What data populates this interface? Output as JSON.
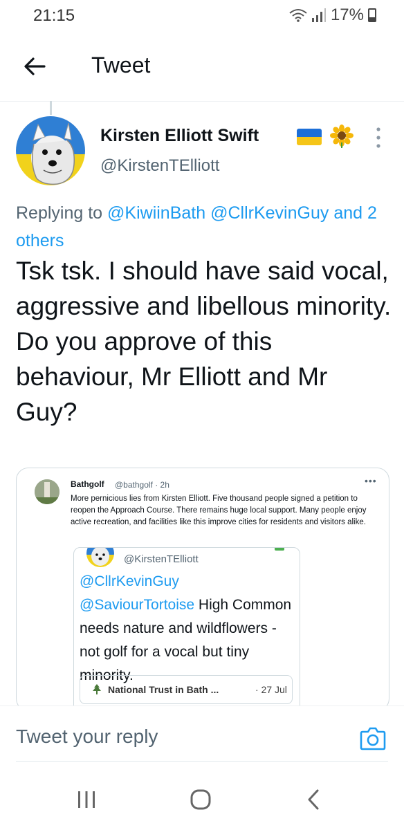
{
  "status_bar": {
    "time": "21:15",
    "battery": "17%"
  },
  "header": {
    "title": "Tweet"
  },
  "tweet": {
    "author_name": "Kirsten Elliott Swift",
    "author_handle": "@KirstenTElliott",
    "replying_prefix": "Replying to",
    "replying_to": [
      "@KiwiinBath",
      "@CllrKevinGuy"
    ],
    "replying_others": "and 2 others",
    "text": "Tsk tsk. I should have said vocal, aggressive  and libellous minority. Do you approve of this behaviour, Mr Elliott and Mr Guy?"
  },
  "embedded_screenshot": {
    "author_name": "Bathgolf",
    "author_meta": "@bathgolf · 2h",
    "text": "More pernicious lies from Kirsten Elliott. Five thousand people signed a petition to reopen the Approach Course. There remains huge local support. Many people enjoy active recreation, and facilities like this improve cities for residents and visitors alike.",
    "quoted": {
      "handle": "@KirstenTElliott",
      "mention_1": "@CllrKevinGuy",
      "mention_2": "@SaviourTortoise",
      "text_after": " High Common needs nature and wildflowers - not golf for a vocal but tiny minority.",
      "link_source": "National Trust in Bath ...",
      "link_date": "· 27 Jul"
    }
  },
  "reply": {
    "placeholder": "Tweet your reply"
  },
  "colors": {
    "accent": "#1d9bf0",
    "text_primary": "#0f1419",
    "text_secondary": "#536471",
    "flag_blue": "#1d6fd8",
    "flag_yellow": "#f5c518"
  },
  "icons": {
    "back": "arrow-left-icon",
    "more": "more-vertical-icon",
    "camera": "camera-icon",
    "nav_recents": "recents-icon",
    "nav_home": "home-icon",
    "nav_back": "chevron-left-icon"
  }
}
